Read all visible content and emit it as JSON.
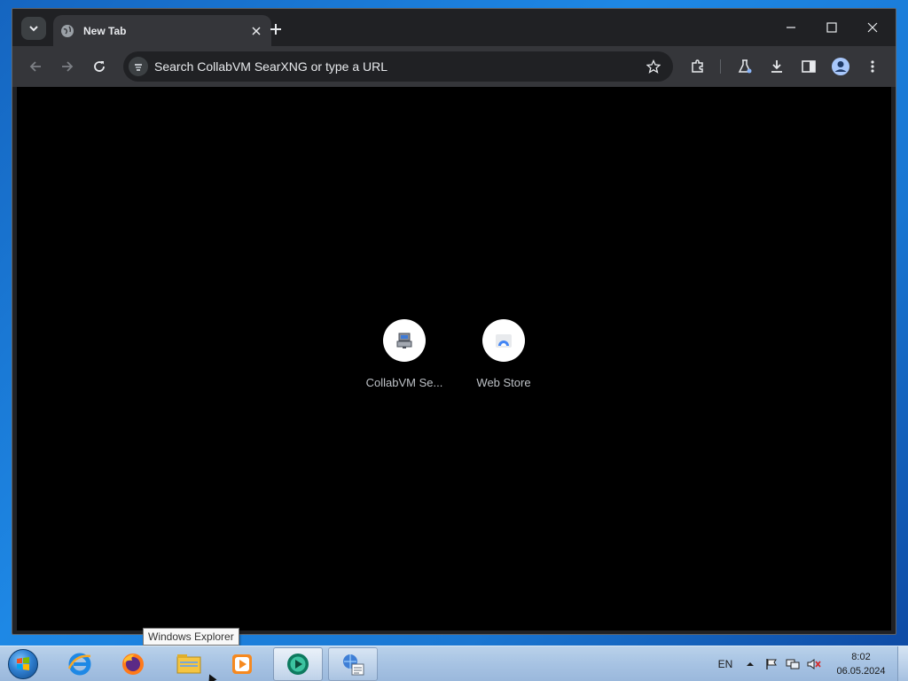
{
  "browser": {
    "tab": {
      "title": "New Tab"
    },
    "omnibox": {
      "placeholder": "Search CollabVM SearXNG or type a URL"
    },
    "shortcuts": [
      {
        "label": "CollabVM Se..."
      },
      {
        "label": "Web Store"
      }
    ]
  },
  "tooltip": {
    "text": "Windows Explorer"
  },
  "taskbar": {
    "apps": [
      {
        "icon": "internet-explorer-icon"
      },
      {
        "icon": "firefox-icon"
      },
      {
        "icon": "windows-explorer-icon"
      },
      {
        "icon": "media-player-icon"
      },
      {
        "icon": "chrome-beta-icon"
      },
      {
        "icon": "network-monitor-icon"
      }
    ],
    "tray": {
      "language": "EN",
      "time": "8:02",
      "date": "06.05.2024"
    }
  },
  "colors": {
    "browser_frame": "#202124",
    "toolbar": "#35363a",
    "content_bg": "#000000",
    "desktop": "#1976d2"
  }
}
